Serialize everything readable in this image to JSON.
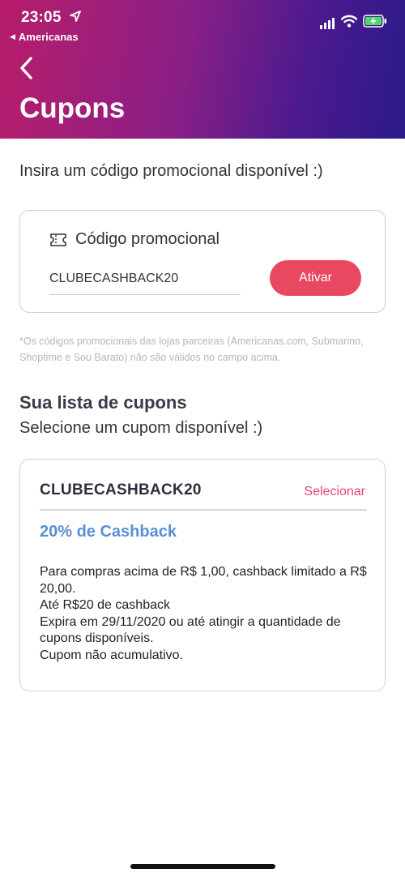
{
  "status_bar": {
    "time": "23:05",
    "back_app": "Americanas"
  },
  "header": {
    "title": "Cupons"
  },
  "intro_text": "Insira um código promocional disponível :)",
  "promo": {
    "label": "Código promocional",
    "input_value": "CLUBECASHBACK20",
    "button_label": "Ativar"
  },
  "disclaimer": "*Os códigos promocionais das lojas parceiras (Americanas.com, Submarino, Shoptime e Sou Barato) não são válidos no campo acima.",
  "coupon_list": {
    "title": "Sua lista de cupons",
    "subtitle": "Selecione um cupom disponível :)",
    "coupons": [
      {
        "code": "CLUBECASHBACK20",
        "select_label": "Selecionar",
        "title": "20% de Cashback",
        "description": [
          "Para compras acima de R$ 1,00, cashback limitado a R$ 20,00.",
          "Até R$20 de cashback",
          "Expira em 29/11/2020 ou até atingir a quantidade de cupons disponíveis.",
          "Cupom não acumulativo."
        ]
      }
    ]
  },
  "colors": {
    "header_gradient_start": "#b81d6a",
    "header_gradient_end": "#2a1a8a",
    "activate_button": "#ea4760",
    "select_link": "#e2486a",
    "coupon_title": "#5b8fd3"
  }
}
